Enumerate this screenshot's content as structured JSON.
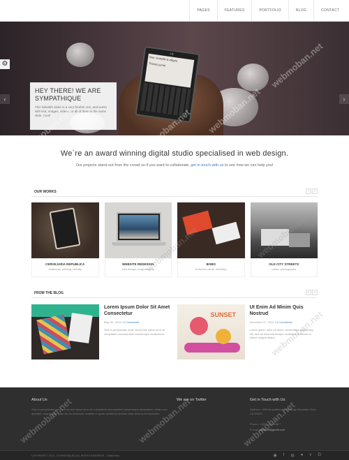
{
  "nav": {
    "items": [
      "PAGES",
      "FEATURES",
      "PORTFOLIO",
      "BLOG",
      "CONTACT"
    ]
  },
  "hero": {
    "caption_title": "HEY THERE! WE ARE SYMPATHIQUE",
    "caption_text": "This fullwidth slider is a very flexible one, and works with text, images, videos, or all of them in the same slide. Cool!",
    "gear_icon": "gear-icon",
    "prev_icon": "chevron-left-icon",
    "next_icon": "chevron-right-icon",
    "phone_brand": "LG",
    "phone_line1": "Brie: Ouiselle & alligna",
    "phone_line2": "Thanos jurnal"
  },
  "watermark": "webmoban.net",
  "tagline": {
    "title": "We`re an award winning digital studio specialised in web design.",
    "text_before": "Our projects stand out from the crowd so if you want to collaborate,",
    "link": "get in touch with us",
    "text_after": "to see how we can help you!"
  },
  "works": {
    "heading": "OUR WORKS",
    "prev": "‹",
    "next": "›",
    "items": [
      {
        "title": "CERVEJARIA REPUBLICA",
        "subtitle": "stationary, printing, identity"
      },
      {
        "title": "WEBSITE REDESIGN",
        "subtitle": "web design, programming"
      },
      {
        "title": "BOBO",
        "subtitle": "business cards, branding"
      },
      {
        "title": "OLD CITY STREETS",
        "subtitle": "urban, photography"
      }
    ]
  },
  "blog": {
    "heading": "FROM THE BLOG",
    "prev": "‹",
    "next": "›",
    "posts": [
      {
        "title": "Lorem Ipsum Dolor Sit Amet Consectetur",
        "date": "May 30, 2013",
        "comments": "0 Comments",
        "excerpt": "Sed ut perspiciatis unde omnis iste natus error sit voluptatem accusantium doloremque laudantium."
      },
      {
        "title": "Ut Enim Ad Minim Quis Nostrud",
        "date": "December 27, 2012",
        "comments": "4 Comments",
        "excerpt": "Lorem ipsum dolor sit amet, consectetur adipisicing elit, sed do eiusmod tempor incididunt ut labore et dolore magna aliqua."
      }
    ]
  },
  "footer": {
    "about_title": "About Us",
    "about_text": "Sed ut perspiciatis unde omnis iste natus error sit voluptatem accusantium doloremque laudantium, totam rem aperiam, eaque ipsa quae ab illo inventore veritatis et quasi architecto beatae vitae dicta sunt explicabo.",
    "twitter_title": "We are on Twitter",
    "contact_title": "Get in Touch with Us",
    "address": "Address: 1600 Amphitheatre Parkway Mountain View, CA 94043",
    "phone": "Phone: +1(07) 123 456 7",
    "email_label": "E-mail:",
    "email": "johndoe@gmail.com",
    "copyright": "COPYRIGHT © 2013 - SYMPATHIQUE | ALL RIGHTS RESERVED - Collect from",
    "social_icons": [
      "rss-icon",
      "twitter-icon",
      "dribbble-icon",
      "flickr-icon",
      "vimeo-icon",
      "google-plus-icon"
    ]
  }
}
